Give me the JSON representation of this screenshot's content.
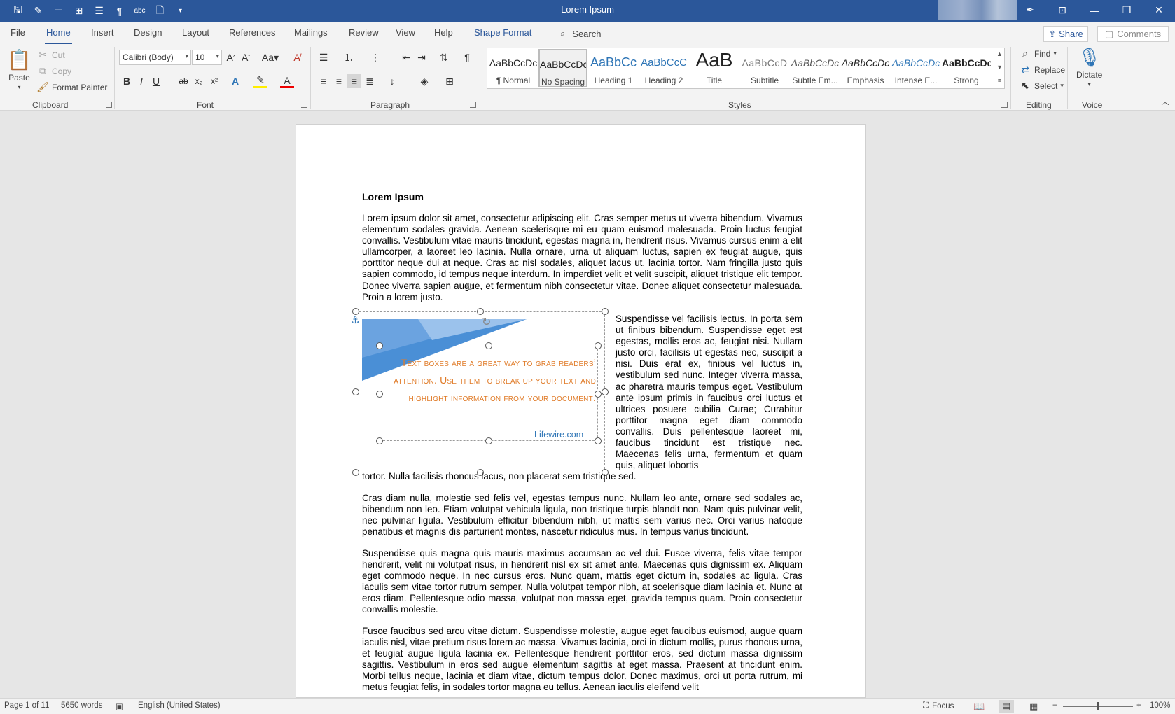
{
  "window": {
    "title": "Lorem Ipsum",
    "quick_access": [
      "save-icon",
      "autosave-icon",
      "open-icon",
      "table-icon",
      "layout-icon",
      "pilcrow-icon",
      "spelling-icon",
      "new-doc-icon",
      "customize-icon"
    ],
    "controls": [
      "pen-icon",
      "ribbon-display-icon",
      "minimize-icon",
      "restore-icon",
      "close-icon"
    ]
  },
  "tabs": [
    "File",
    "Home",
    "Insert",
    "Design",
    "Layout",
    "References",
    "Mailings",
    "Review",
    "View",
    "Help",
    "Shape Format"
  ],
  "active_tab": "Home",
  "search": {
    "placeholder": "Search"
  },
  "share": {
    "label": "Share",
    "comments_label": "Comments"
  },
  "clipboard": {
    "paste": "Paste",
    "cut": "Cut",
    "copy": "Copy",
    "format_painter": "Format Painter",
    "group": "Clipboard"
  },
  "font": {
    "family": "Calibri (Body)",
    "size": "10",
    "group": "Font",
    "case_label": "Aa"
  },
  "paragraph": {
    "group": "Paragraph"
  },
  "styles": {
    "group": "Styles",
    "items": [
      {
        "sample": "AaBbCcDc",
        "name": "¶ Normal"
      },
      {
        "sample": "AaBbCcDc",
        "name": "No Spacing"
      },
      {
        "sample": "AaBbCc",
        "name": "Heading 1"
      },
      {
        "sample": "AaBbCcC",
        "name": "Heading 2"
      },
      {
        "sample": "AaB",
        "name": "Title"
      },
      {
        "sample": "AaBbCcD",
        "name": "Subtitle"
      },
      {
        "sample": "AaBbCcDc",
        "name": "Subtle Em..."
      },
      {
        "sample": "AaBbCcDc",
        "name": "Emphasis"
      },
      {
        "sample": "AaBbCcDc",
        "name": "Intense E..."
      },
      {
        "sample": "AaBbCcDc",
        "name": "Strong"
      }
    ],
    "selected": "No Spacing"
  },
  "editing": {
    "group": "Editing",
    "find": "Find",
    "replace": "Replace",
    "select": "Select"
  },
  "voice": {
    "group": "Voice",
    "dictate": "Dictate"
  },
  "document": {
    "heading": "Lorem Ipsum",
    "para1": "Lorem ipsum dolor sit amet, consectetur adipiscing elit. Cras semper metus ut viverra bibendum. Vivamus elementum sodales gravida. Aenean scelerisque mi eu quam euismod malesuada. Proin luctus feugiat convallis. Vestibulum vitae mauris tincidunt, egestas magna in, hendrerit risus. Vivamus cursus enim a elit ullamcorper, a laoreet leo lacinia. Nulla ornare, urna ut aliquam luctus, sapien ex feugiat augue, quis porttitor neque dui at neque. Cras ac nisl sodales, aliquet lacus ut, lacinia tortor. Nam fringilla justo quis sapien commodo, id tempus neque interdum. In imperdiet velit et velit suscipit, aliquet tristique elit tempor. Donec viverra sapien augue, et fermentum nibh consectetur vitae. Donec aliquet consectetur malesuada. Proin a lorem justo.",
    "para2_wrap": "Suspendisse vel facilisis lectus. In porta sem ut finibus bibendum. Suspendisse eget est egestas, mollis eros ac, feugiat nisi. Nullam justo orci, facilisis ut egestas nec, suscipit a nisi. Duis erat ex, finibus vel luctus in, vestibulum sed nunc. Integer viverra massa, ac pharetra mauris tempus eget. Vestibulum ante ipsum primis in faucibus orci luctus et ultrices posuere cubilia Curae; Curabitur porttitor magna eget diam commodo convallis. Duis pellentesque laoreet mi, faucibus tincidunt est tristique nec. Maecenas felis urna, fermentum et quam quis, aliquet lobortis",
    "para2_tail": "tortor. Nulla facilisis rhoncus lacus, non placerat sem tristique sed.",
    "para3": "Cras diam nulla, molestie sed felis vel, egestas tempus nunc. Nullam leo ante, ornare sed sodales ac, bibendum non leo. Etiam volutpat vehicula ligula, non tristique turpis blandit non. Nam quis pulvinar velit, nec pulvinar ligula. Vestibulum efficitur bibendum nibh, ut mattis sem varius nec. Orci varius natoque penatibus et magnis dis parturient montes, nascetur ridiculus mus. In tempus varius tincidunt.",
    "para4": "Suspendisse quis magna quis mauris maximus accumsan ac vel dui. Fusce viverra, felis vitae tempor hendrerit, velit mi volutpat risus, in hendrerit nisl ex sit amet ante. Maecenas quis dignissim ex. Aliquam eget commodo neque. In nec cursus eros. Nunc quam, mattis eget dictum in, sodales ac ligula. Cras iaculis sem vitae tortor rutrum semper. Nulla volutpat tempor nibh, at scelerisque diam lacinia et. Nunc at eros diam. Pellentesque odio massa, volutpat non massa eget, gravida tempus quam. Proin consectetur convallis molestie.",
    "para5": "Fusce faucibus sed arcu vitae dictum. Suspendisse molestie, augue eget faucibus euismod, augue quam iaculis nisl, vitae pretium risus lorem ac massa. Vivamus lacinia, orci in dictum mollis, purus rhoncus urna, et feugiat augue ligula lacinia ex. Pellentesque hendrerit porttitor eros, sed dictum massa dignissim sagittis. Vestibulum in eros sed augue elementum sagittis at eget massa. Praesent at tincidunt enim. Morbi tellus neque, lacinia et diam vitae, dictum tempus dolor. Donec maximus, orci ut porta rutrum, mi metus feugiat felis, in sodales tortor magna eu tellus. Aenean iaculis eleifend velit",
    "textbox_quote": "Text boxes are a great way to grab readers’ attention. Use them to break up your text and highlight information from your document.",
    "textbox_credit": "Lifewire.com"
  },
  "status": {
    "page": "Page 1 of 11",
    "words": "5650 words",
    "language": "English (United States)",
    "focus": "Focus",
    "zoom": "100%",
    "zoom_level_fraction": 0.5
  },
  "colors": {
    "brand": "#2b579a",
    "quote": "#e07b28",
    "link": "#2e75b6"
  }
}
